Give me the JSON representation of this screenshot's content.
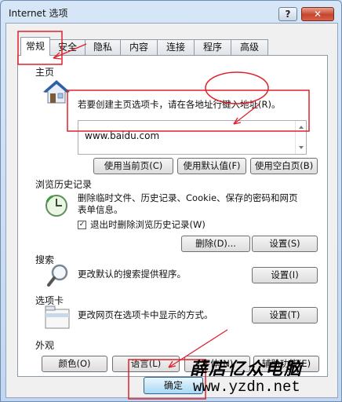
{
  "window": {
    "title": "Internet 选项",
    "help": "?",
    "close": "✕"
  },
  "tabs": [
    "常规",
    "安全",
    "隐私",
    "内容",
    "连接",
    "程序",
    "高级"
  ],
  "homepage": {
    "title": "主页",
    "desc": "若要创建主页选项卡，请在各地址行键入地址(R)。",
    "url": "www.baidu.com",
    "buttons": [
      "使用当前页(C)",
      "使用默认值(F)",
      "使用空白页(B)"
    ]
  },
  "history": {
    "title": "浏览历史记录",
    "desc_line1": "删除临时文件、历史记录、Cookie、保存的密码和网页",
    "desc_line2": "表单信息。",
    "checkbox_label": "退出时删除浏览历史记录(W)",
    "checkbox_checked": true,
    "delete_button": "删除(D)...",
    "settings_button": "设置(S)"
  },
  "search": {
    "title": "搜索",
    "desc": "更改默认的搜索提供程序。",
    "settings_button": "设置(I)"
  },
  "tabs_section": {
    "title": "选项卡",
    "desc": "更改网页在选项卡中显示的方式。",
    "settings_button": "设置(T)"
  },
  "appearance": {
    "title": "外观",
    "buttons": [
      "颜色(O)",
      "语言(L)",
      "字体(N)",
      "辅助功能(E)"
    ]
  },
  "footer": {
    "ok_button": "确定"
  },
  "watermark": {
    "text": "薛店亿众电脑",
    "url": "www.yzdn.net"
  },
  "colors": {
    "annotation": "#e0202a"
  }
}
